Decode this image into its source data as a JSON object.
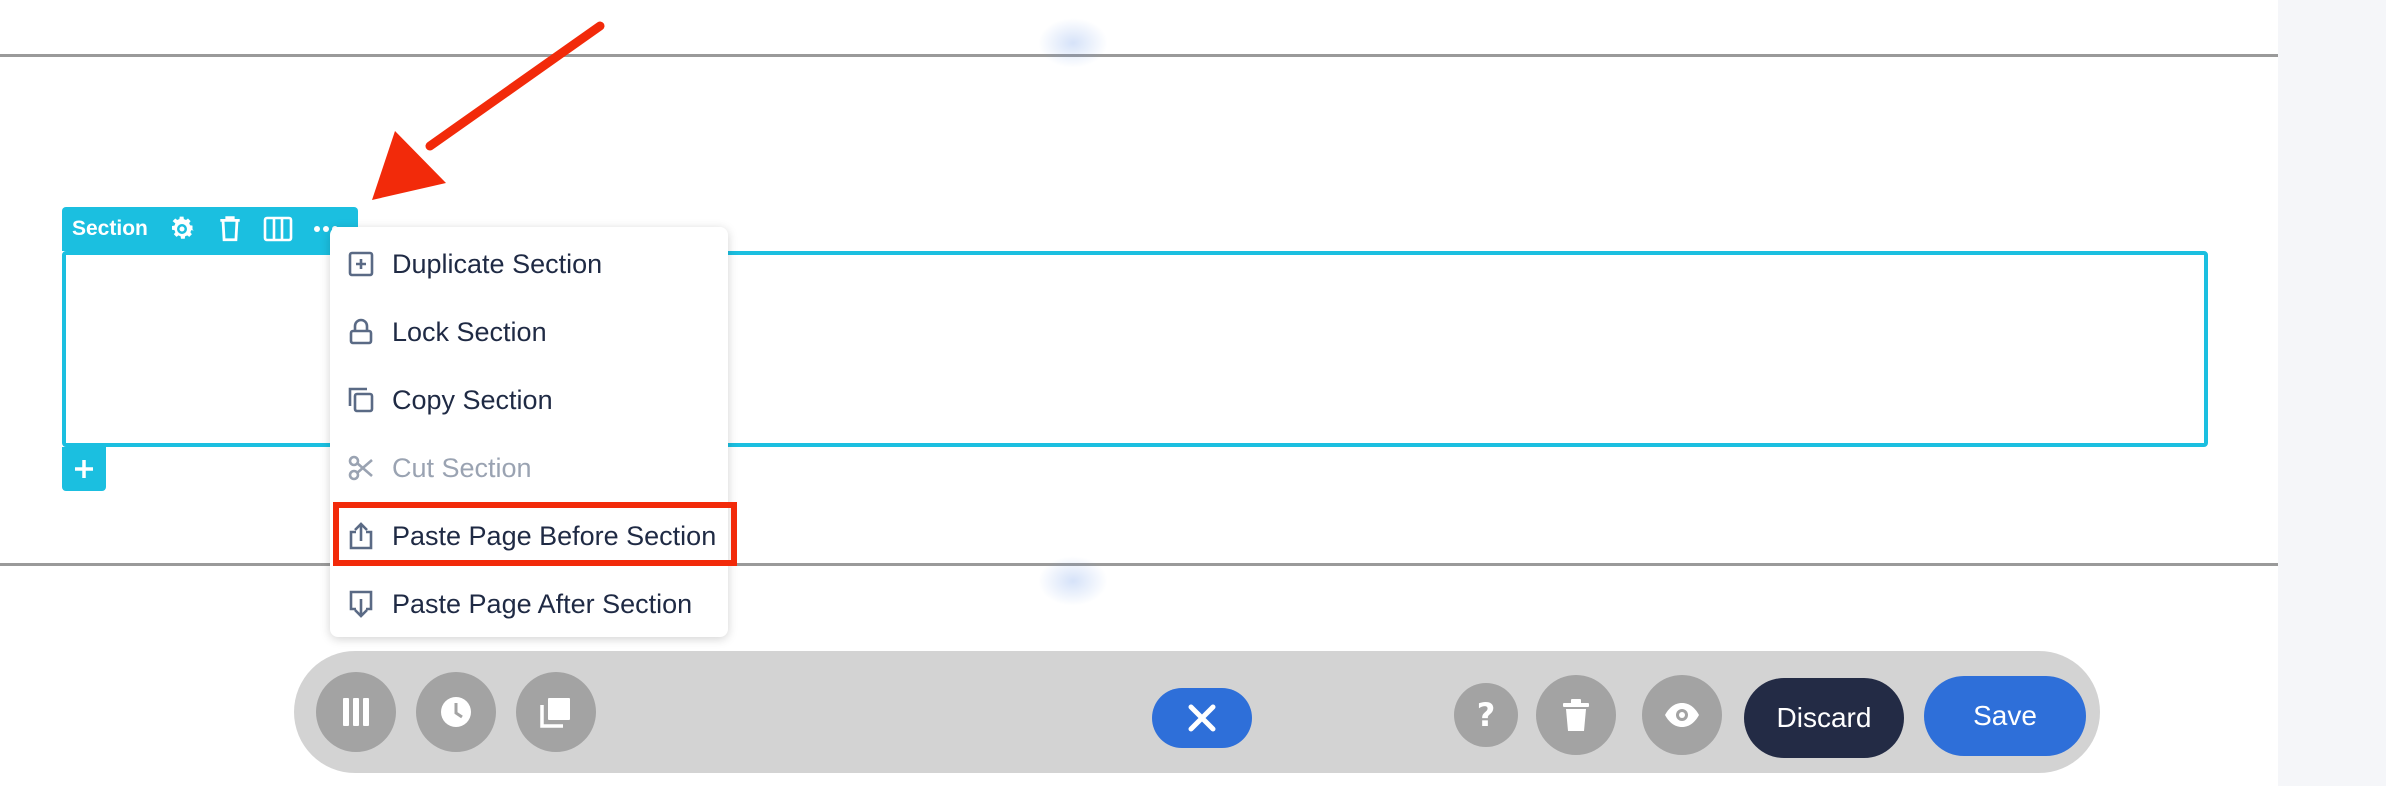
{
  "section_toolbar": {
    "label": "Section",
    "icons": [
      "gear-icon",
      "trash-icon",
      "columns-icon",
      "more-icon"
    ]
  },
  "context_menu": {
    "items": [
      {
        "label": "Duplicate Section",
        "icon": "duplicate-icon",
        "disabled": false
      },
      {
        "label": "Lock Section",
        "icon": "lock-icon",
        "disabled": false
      },
      {
        "label": "Copy Section",
        "icon": "copy-icon",
        "disabled": false
      },
      {
        "label": "Cut Section",
        "icon": "scissors-icon",
        "disabled": true
      },
      {
        "label": "Paste Page Before Section",
        "icon": "paste-before-icon",
        "disabled": false,
        "highlighted": true
      },
      {
        "label": "Paste Page After Section",
        "icon": "paste-after-icon",
        "disabled": false
      }
    ]
  },
  "bottom_toolbar": {
    "left_icons": [
      "columns-icon",
      "history-icon",
      "layers-icon"
    ],
    "center_icon": "close-icon",
    "right_icons": [
      "help-icon",
      "trash-icon",
      "eye-icon"
    ],
    "discard_label": "Discard",
    "save_label": "Save"
  },
  "colors": {
    "section_accent": "#1bbfe0",
    "annotation_red": "#f22a0a",
    "primary_blue": "#2e6fd9",
    "discard_dark": "#232b45",
    "toolbar_gray": "#d3d3d3"
  }
}
